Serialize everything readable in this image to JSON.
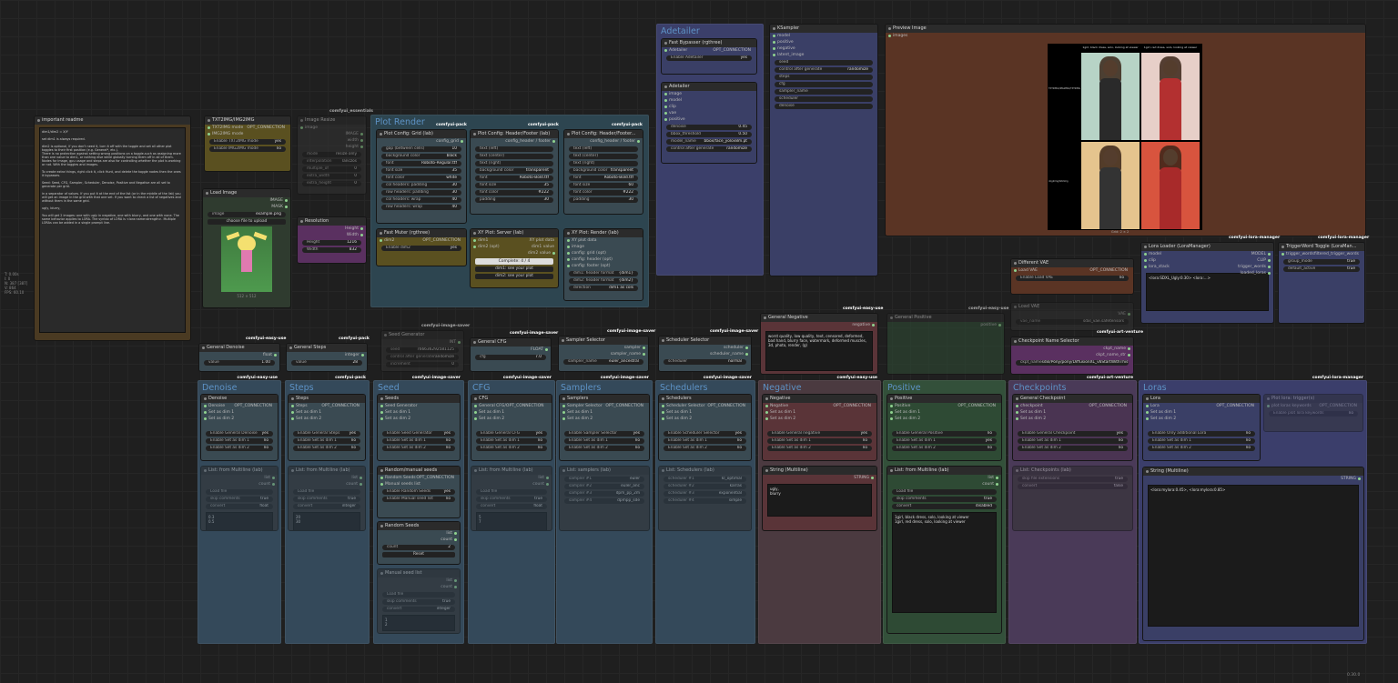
{
  "stats": {
    "lines": [
      "T: 0.00s",
      "I: 0",
      "N: 387 [387]",
      "V: 864",
      "FPS: 60.10"
    ]
  },
  "groups": [
    {
      "title": "Plot Render",
      "tags": [
        "comfyui-pack",
        "comfyui-pack",
        "comfyui-pack"
      ]
    },
    {
      "title": "Adetailer"
    },
    {
      "title": "Denoise",
      "tag": "comfyui-easy-use"
    },
    {
      "title": "Steps",
      "tag": "comfyui-pack"
    },
    {
      "title": "Seed",
      "tag": "comfyui-image-saver"
    },
    {
      "title": "CFG",
      "tag": "comfyui-image-saver"
    },
    {
      "title": "Samplers",
      "tag": "comfyui-image-saver"
    },
    {
      "title": "Schedulers",
      "tag": "comfyui-image-saver"
    },
    {
      "title": "Negative",
      "tag": "comfyui-easy-use"
    },
    {
      "title": "Positive"
    },
    {
      "title": "Checkpoints",
      "tag": "comfyui-art-venture"
    },
    {
      "title": "Loras",
      "tag": "comfyui-lora-manager"
    }
  ],
  "nodes": {
    "readme": {
      "title": "important readme",
      "text": "dim1/dim2 = X/Y\n\nset dim1 is always required.\n\ndim2 is optional, if you don't need it, turn it off with the toggle and set all other plot toggles to their first position (e.g. General*, etc.).\nThere is no protection against setting wrong positions on a toggle-such as assigning more than one value to dim1, or nothing else while globally turning them off in all of them. Nodes for image, gpu usage and steps are also for controlling whether the plot is working or not. With the toggles and images.\n\nTo create extra things, right click it, click Hunt, and delete the toggle nodes then the ones it bypasses.\n\nSeed: Seed, CFG, Sampler, Scheduler, Denoise, Positive and Negative are all set to generate per grid.\n\nin a separator of values. If you put it at the end of the list (or in the middle of the list) you will get an image in the grid with that one set. If you want to check a list of negatives and without them in the same grid.\n\nugly, blurry,\n\nYou will get 2 images: one with ugly in negative, one with blurry, and one with none. The same behavior applies to LORA. The syntax of LORA is <lora:name:strength>. Multiple LORAs can be added in a single prompt line."
    },
    "txt2img": {
      "title": "TXT2IMG/IMG2IMG",
      "out1": "TXT2IMG mode",
      "out1t": "OPT_CONNECTION",
      "out2": "IMG2IMG mode",
      "w1": "Enable TXT2IMG mode",
      "w1v": "yes",
      "w2": "Enable IMG2IMG mode",
      "w2v": "no"
    },
    "imgresize": {
      "title": "Image Resize",
      "in": "image",
      "o1": "IMAGE",
      "o2": "width",
      "o3": "height",
      "ws": [
        [
          "mode",
          "resize only"
        ],
        [
          "interpolation",
          "lanczos"
        ],
        [
          "multiple_of",
          "0"
        ],
        [
          "extra_width",
          "0"
        ],
        [
          "extra_height",
          "0"
        ]
      ],
      "tag": "comfyui_essentials"
    },
    "loadimage": {
      "title": "Load Image",
      "o1": "IMAGE",
      "o2": "MASK",
      "w": "image",
      "wv": "example.png",
      "up": "choose file to upload",
      "size": "512 × 512"
    },
    "resolution": {
      "title": "Resolution",
      "o1": "Height",
      "o2": "Width",
      "w1": "Height",
      "w1v": "1216",
      "w2": "Width",
      "w2v": "832"
    },
    "plotgrid": {
      "title": "Plot Config: Grid (lab)",
      "o": "config_grid",
      "ws": [
        [
          "gap (between cells)",
          "10"
        ],
        [
          "background color",
          "black"
        ],
        [
          "font",
          "Roboto-Regular.ttf"
        ],
        [
          "font size",
          "35"
        ],
        [
          "font color",
          "white"
        ],
        [
          "col headers: padding",
          "30"
        ],
        [
          "row headers: padding",
          "30"
        ],
        [
          "col headers: wrap",
          "40"
        ],
        [
          "row headers: wrap",
          "40"
        ]
      ]
    },
    "plotheader1": {
      "title": "Plot Config: Header/Footer (lab)",
      "o": "config_header / footer",
      "ws": [
        [
          "text (left)",
          ""
        ],
        [
          "text (center)",
          ""
        ],
        [
          "text (right)",
          ""
        ],
        [
          "background color",
          "transparent"
        ],
        [
          "font",
          "Roboto-Bold.ttf"
        ],
        [
          "font size",
          "35"
        ],
        [
          "font color",
          "#222"
        ],
        [
          "padding",
          "30"
        ]
      ]
    },
    "plotheader2": {
      "title": "Plot Config: Header/Footer...",
      "o": "config_header / footer",
      "ws": [
        [
          "text (left)",
          ""
        ],
        [
          "text (center)",
          ""
        ],
        [
          "text (right)",
          ""
        ],
        [
          "background color",
          "transparent"
        ],
        [
          "font",
          "Roboto-Bold.ttf"
        ],
        [
          "font size",
          "60"
        ],
        [
          "font color",
          "#222"
        ],
        [
          "padding",
          "30"
        ]
      ]
    },
    "fastmuter": {
      "title": "Fast Muter (rgthree)",
      "in": "dim2",
      "o": "OPT_CONNECTION",
      "w": "Enable dim2",
      "wv": "yes"
    },
    "xyplotdata": {
      "title": "XY Plot: Server (lab)",
      "i1": "dim1",
      "i2": "dim2 (opt)",
      "o1": "XY plot data",
      "o2": "dim1 value",
      "o3": "dim2 value",
      "prog": "Complete: 4 / 4",
      "w1": "dim1: see your plot",
      "w2": "dim2: see your plot"
    },
    "xyplotrender": {
      "title": "XY Plot: Render (lab)",
      "ins": [
        "XY plot data",
        "image",
        "config: grid (opt)",
        "config: header (opt)",
        "config: footer (opt)"
      ],
      "o1": "grid",
      "o2": "image",
      "ws": [
        [
          "dim1: header format",
          "{dim1}"
        ],
        [
          "dim2: header format",
          "{dim2}"
        ],
        [
          "direction",
          "dim1 as cols"
        ]
      ]
    },
    "fastbypasser": {
      "title": "Fast Bypasser (rgthree)",
      "in": "Adetailer",
      "o": "OPT_CONNECTION",
      "w": "Enable Adetailer",
      "wv": "yes"
    },
    "adetailer": {
      "title": "Adetailer",
      "ins": [
        "image",
        "model",
        "clip",
        "vae",
        "positive"
      ],
      "o": "image",
      "ws": [
        [
          "denoise",
          "0.45"
        ],
        [
          "bbox_threshold",
          "0.50"
        ],
        [
          "model_name",
          "bbox/face_yolov8m.pt"
        ],
        [
          "control after generate",
          "randomize"
        ]
      ]
    },
    "ksampler": {
      "title": "KSampler",
      "ins": [
        "model",
        "positive",
        "negative",
        "latent_image"
      ],
      "o": "LATENT",
      "ws": [
        [
          "seed",
          ""
        ],
        [
          "control after generate",
          "randomize"
        ],
        [
          "steps",
          ""
        ],
        [
          "cfg",
          ""
        ],
        [
          "sampler_name",
          ""
        ],
        [
          "scheduler",
          ""
        ],
        [
          "denoise",
          ""
        ]
      ]
    },
    "preview": {
      "title": "Preview Image",
      "in": "images",
      "hdr1": "1girl, black dress, solo, looking at viewer",
      "hdr2": "1girl, red dress, solo, looking at viewer",
      "row1": "TXT2IMG/IMG2IMG/TXT2IMG",
      "row2": "img2img/txt2img",
      "size": "Grid: 2 × 2"
    },
    "loraloader": {
      "title": "Lora Loader (LoraManager)",
      "ins": [
        "model",
        "clip",
        "lora_stack"
      ],
      "outs": [
        "MODEL",
        "CLIP",
        "trigger_words",
        "loaded_loras"
      ],
      "text": "<lora:SDXL_Ugly:0.30> <lora:...>",
      "tag": "comfyui-lora-manager"
    },
    "triggerword": {
      "title": "TriggerWord Toggle (LoraMan...",
      "ins": [
        "trigger_words"
      ],
      "o": "filtered_trigger_words",
      "ws": [
        [
          "group_mode",
          "true"
        ],
        [
          "default_active",
          "true"
        ]
      ],
      "tag": "comfyui-lora-manager"
    },
    "diffvae": {
      "title": "Different VAE",
      "in": "Load VAE",
      "o": "OPT_CONNECTION",
      "w": "Enable Load VAE",
      "wv": "no"
    },
    "loadvae": {
      "title": "Load VAE",
      "o": "VAE",
      "w": "vae_name",
      "wv": "sdxl_vae.safetensors"
    },
    "ckptselector": {
      "title": "Checkpoint Name Selector",
      "o1": "ckpt_name",
      "o2": "ckpt_name_str",
      "w": "ckpt_name",
      "wv": "sdxl/Pony/pony/DiffusionXL_v6StartWithThis",
      "tag": "comfyui-art-venture"
    },
    "genneg": {
      "title": "General Negative",
      "o": "negative",
      "text": "worst quality, low quality, text, censored, deformed, bad hand, blurry face, watermark, deformed muscles, 3d, photo, render, (g)",
      "tag": "comfyui-easy-use"
    },
    "genpos": {
      "title": "General Positive",
      "o": "positive",
      "tag": "comfyui-easy-use"
    },
    "gendenoise": {
      "title": "General Denoise",
      "o": "float",
      "w": "value",
      "wv": "1.00",
      "tag": "comfyui-easy-use"
    },
    "gensteps": {
      "title": "General Steps",
      "o": "integer",
      "w": "value",
      "wv": "28",
      "tag": "comfyui-pack"
    },
    "seedgen": {
      "title": "Seed Generator",
      "o": "INT",
      "ws": [
        [
          "seed",
          "766636292581125"
        ],
        [
          "control after generate",
          "randomize"
        ],
        [
          "increment",
          "0"
        ]
      ],
      "tag": "comfyui-image-saver"
    },
    "gencfg": {
      "title": "General CFG",
      "o": "FLOAT",
      "w": "cfg",
      "wv": "7.0",
      "tag": "comfyui-image-saver"
    },
    "samplersel": {
      "title": "Sampler Selector",
      "o1": "sampler",
      "o2": "sampler_name",
      "w": "sampler_name",
      "wv": "euler_ancestral",
      "tag": "comfyui-image-saver"
    },
    "schedsel": {
      "title": "Scheduler Selector",
      "o1": "scheduler",
      "o2": "scheduler_name",
      "w": "scheduler",
      "wv": "normal",
      "tag": "comfyui-image-saver"
    },
    "colnodes": [
      {
        "key": "denoise",
        "title": "Denoise",
        "outs": [
          "Denoise",
          "Set as dim 1",
          "Set as dim 2"
        ],
        "o": "OPT_CONNECTION",
        "ws": [
          [
            "Enable General Denoise",
            "yes"
          ],
          [
            "Enable Set as dim 1",
            "no"
          ],
          [
            "Enable Set as dim 2",
            "no"
          ]
        ],
        "list": "List: from Multiline (lab)",
        "lo": [
          "list",
          "count"
        ],
        "lw": [
          [
            "Load file",
            ""
          ],
          [
            "skip comments",
            "true"
          ],
          [
            "convert",
            "float"
          ]
        ],
        "v": "0.3\n0.5"
      },
      {
        "key": "steps",
        "title": "Steps",
        "outs": [
          "Steps",
          "Set as dim 1",
          "Set as dim 2"
        ],
        "o": "OPT_CONNECTION",
        "ws": [
          [
            "Enable General Steps",
            "yes"
          ],
          [
            "Enable Set as dim 1",
            "no"
          ],
          [
            "Enable Set as dim 2",
            "no"
          ]
        ],
        "list": "List: from Multiline (lab)",
        "lo": [
          "list",
          "count"
        ],
        "lw": [
          [
            "Load file",
            ""
          ],
          [
            "skip comments",
            "true"
          ],
          [
            "convert",
            "integer"
          ]
        ],
        "v": "20\n30"
      },
      {
        "key": "seed",
        "title": "Seeds",
        "outs": [
          "Seed Generator",
          "Set as dim 1",
          "Set as dim 2"
        ],
        "o": "OPT_CONNECTION",
        "ws": [
          [
            "Enable Seed Generator",
            "yes"
          ],
          [
            "Enable Set as dim 1",
            "no"
          ],
          [
            "Enable Set as dim 2",
            "no"
          ]
        ]
      },
      {
        "key": "cfg",
        "title": "CFG",
        "outs": [
          "General CFG/OPT_CONNECTION",
          "Set as dim 1",
          "Set as dim 2"
        ],
        "o": "",
        "ws": [
          [
            "Enable General CFG",
            "yes"
          ],
          [
            "Enable Set as dim 1",
            "no"
          ],
          [
            "Enable Set as dim 2",
            "no"
          ]
        ],
        "list": "List: from Multiline (lab)",
        "lo": [
          "list",
          "count"
        ],
        "lw": [
          [
            "Load file",
            ""
          ],
          [
            "skip comments",
            "true"
          ],
          [
            "convert",
            "float"
          ]
        ],
        "v": "5\n7"
      },
      {
        "key": "samplers",
        "title": "Samplers",
        "outs": [
          "Sampler Selector",
          "Set as dim 1",
          "Set as dim 2"
        ],
        "o": "OPT_CONNECTION",
        "ws": [
          [
            "Enable Sampler Selector",
            "yes"
          ],
          [
            "Enable Set as dim 1",
            "no"
          ],
          [
            "Enable Set as dim 2",
            "no"
          ]
        ],
        "list": "List: samplers (lab)",
        "lo": [],
        "lw": [
          [
            "sampler #1",
            "euler"
          ],
          [
            "sampler #2",
            "euler_anc"
          ],
          [
            "sampler #3",
            "dpm_pp_2m"
          ],
          [
            "sampler #4",
            "dpmpp_sde"
          ]
        ],
        "v": ""
      },
      {
        "key": "schedulers",
        "title": "Schedulers",
        "outs": [
          "Scheduler Selector",
          "Set as dim 1",
          "Set as dim 2"
        ],
        "o": "OPT_CONNECTION",
        "ws": [
          [
            "Enable Scheduler Selector",
            "yes"
          ],
          [
            "Enable Set as dim 1",
            "no"
          ],
          [
            "Enable Set as dim 2",
            "no"
          ]
        ],
        "list": "List: Schedulers (lab)",
        "lo": [],
        "lw": [
          [
            "scheduler #1",
            "kl_optimal"
          ],
          [
            "scheduler #2",
            "karras"
          ],
          [
            "scheduler #3",
            "exponential"
          ],
          [
            "scheduler #4",
            "simple"
          ]
        ],
        "v": ""
      },
      {
        "key": "negative",
        "title": "Negative",
        "outs": [
          "Negative",
          "Set as dim 1",
          "Set as dim 2"
        ],
        "o": "OPT_CONNECTION",
        "ws": [
          [
            "Enable General negative",
            "yes"
          ],
          [
            "Enable Set as dim 1",
            "no"
          ],
          [
            "Enable Set as dim 2",
            "no"
          ]
        ],
        "list": "String (Multiline)",
        "lo": [
          "STRING"
        ],
        "lw": [],
        "v": "ugly,\nblurry"
      },
      {
        "key": "positive",
        "title": "Positive",
        "outs": [
          "Positive",
          "Set as dim 1",
          "Set as dim 2"
        ],
        "o": "OPT_CONNECTION",
        "ws": [
          [
            "Enable General Positive",
            "no"
          ],
          [
            "Enable Set as dim 1",
            "yes"
          ],
          [
            "Enable Set as dim 2",
            "no"
          ]
        ],
        "list": "List: from Multiline (lab)",
        "lo": [
          "list",
          "count"
        ],
        "lw": [
          [
            "Load file",
            ""
          ],
          [
            "skip comments",
            "true"
          ],
          [
            "convert",
            "disabled"
          ]
        ],
        "v": "1girl, black dress, solo, looking at viewer\n1girl, red dress, solo, looking at viewer"
      },
      {
        "key": "checkpoints",
        "title": "General Checkpoint",
        "outs": [
          "checkpoint",
          "Set as dim 1",
          "Set as dim 2"
        ],
        "o": "OPT_CONNECTION",
        "ws": [
          [
            "Enable General Checkpoint",
            "yes"
          ],
          [
            "Enable Set as dim 1",
            "no"
          ],
          [
            "Enable Set as dim 2",
            "no"
          ]
        ],
        "list": "List: Checkpoints (lab)",
        "lo": [],
        "lw": [
          [
            "skip file extensions",
            "true"
          ],
          [
            "convert",
            "false"
          ]
        ],
        "v": ""
      },
      {
        "key": "loras",
        "title": "Lora",
        "outs": [
          "Lora",
          "Set as dim 1",
          "Set as dim 2"
        ],
        "o": "OPT_CONNECTION",
        "ws": [
          [
            "Enable Only additional Lora",
            "no"
          ],
          [
            "Enable Set as dim 1",
            "no"
          ],
          [
            "Enable Set as dim 2",
            "no"
          ]
        ],
        "list": "String (Multiline)",
        "lo": [
          "STRING"
        ],
        "lw": [],
        "v": "<lora:mylora:0.45>, <lora:mylora:0.85>"
      }
    ],
    "randseeds": {
      "title": "Random/manual seeds",
      "outs": [
        "Random Seeds",
        "Manual seeds list"
      ],
      "o": "OPT_CONNECTION",
      "ws": [
        [
          "Enable Random Seeds",
          "yes"
        ],
        [
          "Enable Manual seed list",
          "no"
        ]
      ]
    },
    "randomseeds": {
      "title": "Random Seeds",
      "o1": "list",
      "o2": "count",
      "w": "count",
      "wv": "2",
      "btn": "Reset"
    },
    "manualseedlist": {
      "title": "Manual seed list",
      "o1": "list",
      "o2": "count",
      "lw": [
        [
          "Load file",
          ""
        ],
        [
          "skip comments",
          "true"
        ],
        [
          "convert",
          "integer"
        ]
      ],
      "v": "1\n2"
    },
    "plotloratrigger": {
      "title": "Plot lora: trigger(s)",
      "ins": [
        "plot loras keywords"
      ],
      "o": "OPT_CONNECTION",
      "w": "Enable plot lora keywords",
      "wv": "no"
    }
  },
  "version": "0.30.0"
}
